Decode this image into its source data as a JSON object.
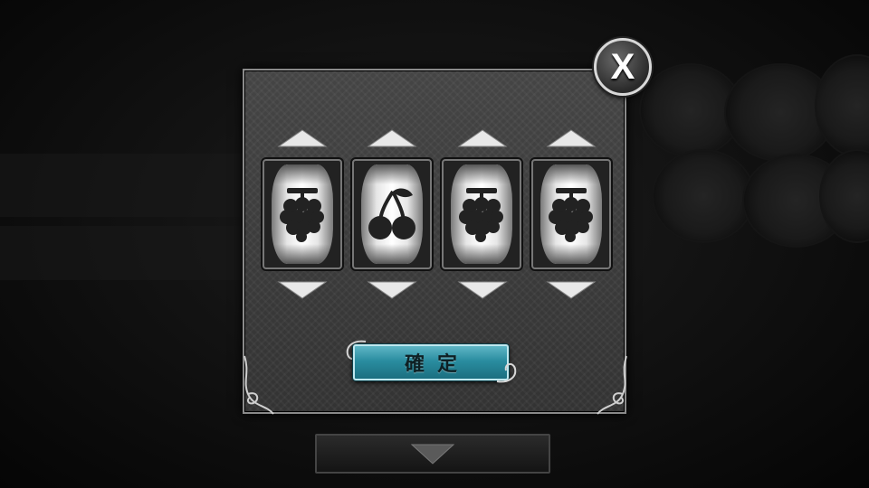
{
  "dialog": {
    "close_label": "X",
    "confirm_label": "確定"
  },
  "reels": [
    {
      "symbol": "grape-icon"
    },
    {
      "symbol": "cherry-icon"
    },
    {
      "symbol": "grape-icon"
    },
    {
      "symbol": "grape-icon"
    }
  ],
  "colors": {
    "panel": "#3a3a3a",
    "confirm_button": "#2a8da0",
    "symbol": "#222222"
  },
  "icons": {
    "up_arrow": "triangle-up-icon",
    "down_arrow": "triangle-down-icon",
    "scroll_down": "chevron-down-icon"
  }
}
